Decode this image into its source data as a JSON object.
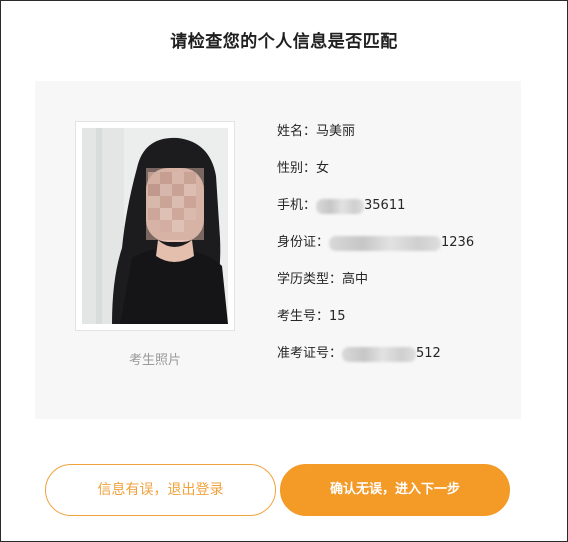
{
  "dialog": {
    "title": "请检查您的个人信息是否匹配"
  },
  "photo": {
    "caption": "考生照片"
  },
  "fields": {
    "name": {
      "label": "姓名：",
      "value": "马美丽"
    },
    "gender": {
      "label": "性别：",
      "value": "女"
    },
    "phone": {
      "label": "手机：",
      "value": "35611"
    },
    "id_card": {
      "label": "身份证：",
      "value": "1236"
    },
    "education": {
      "label": "学历类型：",
      "value": "高中"
    },
    "candidate_no": {
      "label": "考生号：",
      "value": "15"
    },
    "admission_no": {
      "label": "准考证号：",
      "value": "512"
    }
  },
  "buttons": {
    "error_label": "信息有误，退出登录",
    "confirm_label": "确认无误，进入下一步"
  },
  "colors": {
    "accent": "#f39a27",
    "panel_bg": "#f7f7f7"
  }
}
